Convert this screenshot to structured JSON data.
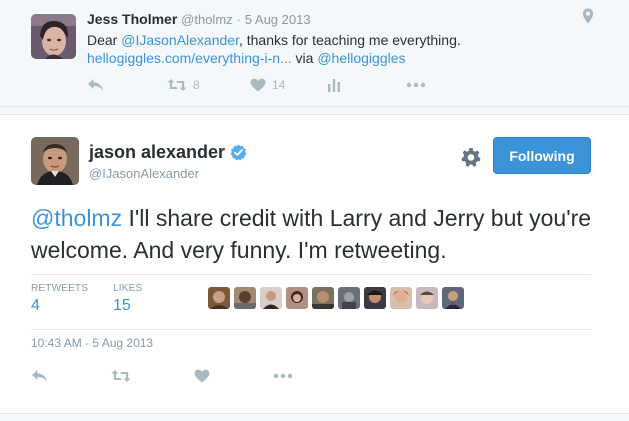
{
  "parent_tweet": {
    "fullname": "Jess Tholmer",
    "handle": "@tholmz",
    "separator": "·",
    "time": "5 Aug 2013",
    "text_before": "Dear ",
    "mention": "@IJasonAlexander",
    "text_after": ", thanks for teaching me everything.",
    "link": "hellogiggles.com/everything-i-n...",
    "via_text": " via ",
    "via_mention": "@hellogiggles",
    "retweet_count": "8",
    "like_count": "14"
  },
  "main_tweet": {
    "fullname": "jason alexander",
    "handle": "@IJasonAlexander",
    "follow_label": "Following",
    "mention": "@tholmz",
    "text": " I'll share credit with Larry and Jerry but you're welcome. And very funny. I'm retweeting.",
    "retweets_label": "RETWEETS",
    "retweets_value": "4",
    "likes_label": "LIKES",
    "likes_value": "15",
    "timestamp": "10:43 AM - 5 Aug 2013"
  },
  "colors": {
    "accent": "#3b94d9",
    "muted": "#8899a6",
    "icon": "#aab8c2",
    "background": "#f5f8fa"
  },
  "icons": [
    "reply-icon",
    "retweet-icon",
    "heart-icon",
    "analytics-icon",
    "more-icon",
    "location-pin-icon",
    "verified-badge-icon",
    "gear-icon"
  ]
}
